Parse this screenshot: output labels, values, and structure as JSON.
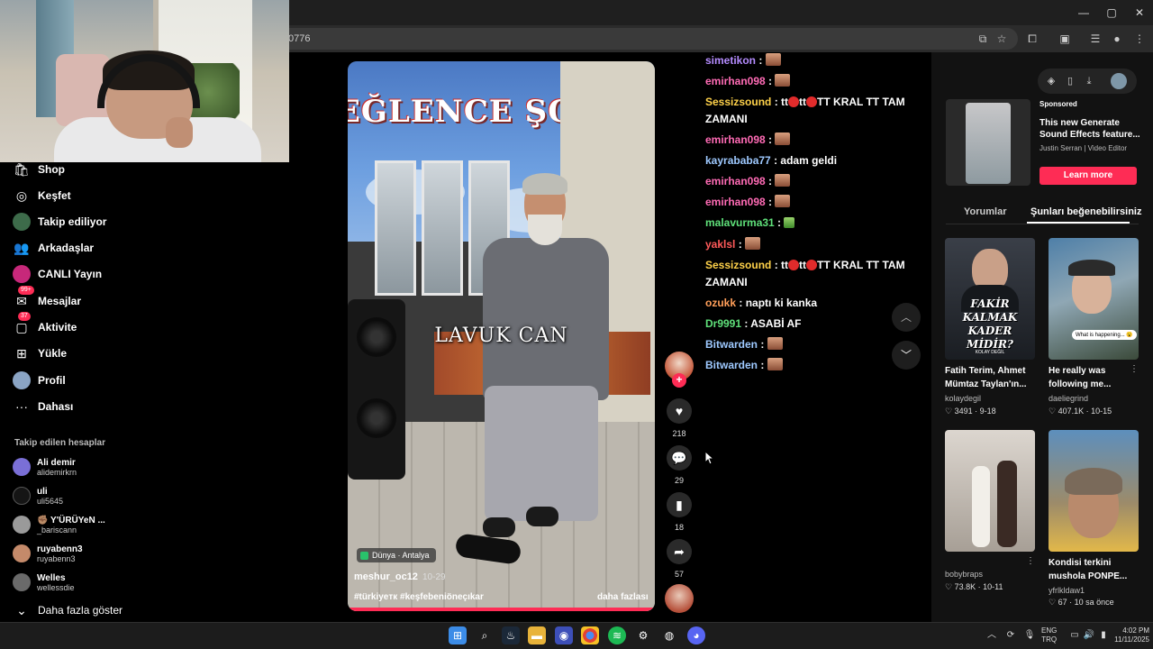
{
  "browser": {
    "url": "0776",
    "window_controls": [
      "—",
      "▢",
      "✕"
    ]
  },
  "sidebar": {
    "nav": [
      {
        "label": "Shop",
        "icon": "shop-icon"
      },
      {
        "label": "Keşfet",
        "icon": "explore-icon"
      },
      {
        "label": "Takip ediliyor",
        "icon": "following-avatar-icon"
      },
      {
        "label": "Arkadaşlar",
        "icon": "friends-icon"
      },
      {
        "label": "CANLI Yayın",
        "icon": "live-avatar-icon"
      },
      {
        "label": "Mesajlar",
        "icon": "messages-icon",
        "badge": "99+"
      },
      {
        "label": "Aktivite",
        "icon": "activity-icon",
        "badge": "37"
      },
      {
        "label": "Yükle",
        "icon": "upload-icon"
      },
      {
        "label": "Profil",
        "icon": "profile-avatar-icon"
      },
      {
        "label": "Dahası",
        "icon": "more-icon"
      }
    ],
    "following_title": "Takip edilen hesaplar",
    "accounts": [
      {
        "name": "Ali demir",
        "handle": "alidemirkrn",
        "color": "#7a6fd6"
      },
      {
        "name": "uli",
        "handle": "uli5645",
        "color": "#111111"
      },
      {
        "name": "✊🏽 Y'ÜRÜYeN ...",
        "handle": "_bariscann",
        "color": "#9a9a9a"
      },
      {
        "name": "ruyabenn3",
        "handle": "ruyabenn3",
        "color": "#c48a6a"
      },
      {
        "name": "Welles",
        "handle": "wellessdie",
        "color": "#6a6a6a"
      }
    ],
    "show_more": "Daha fazla göster"
  },
  "video": {
    "banner_text": "EĞLENCE ŞOV",
    "overlay_text": "LAVUK CAN",
    "location": "Dünya · Antalya",
    "username": "meshur_oc12",
    "date": "10-29",
    "hashtags": "#türkiyeтк #keşfebeniöneçıkar",
    "more_label": "daha fazlası",
    "progress": 1.0
  },
  "actions": {
    "likes": "218",
    "comments": "29",
    "saves": "18",
    "shares": "57"
  },
  "chat": [
    {
      "user": "simetikon",
      "color": "#b58cff",
      "msg": "",
      "emote": "face"
    },
    {
      "user": "emirhan098",
      "color": "#ff6bb5",
      "msg": "",
      "emote": "face"
    },
    {
      "user": "Sessizsound",
      "color": "#ffd24a",
      "msg": "tt",
      "msg2": "tt",
      "msg3": "TT KRAL TT TAM ZAMANI",
      "emote": "reddots"
    },
    {
      "user": "emirhan098",
      "color": "#ff6bb5",
      "msg": "",
      "emote": "face"
    },
    {
      "user": "kayrababa77",
      "color": "#9ec9ff",
      "msg": "adam geldi",
      "emote": ""
    },
    {
      "user": "emirhan098",
      "color": "#ff6bb5",
      "msg": "",
      "emote": "face"
    },
    {
      "user": "emirhan098",
      "color": "#ff6bb5",
      "msg": "",
      "emote": "face"
    },
    {
      "user": "malavurma31",
      "color": "#5fe07a",
      "msg": "",
      "emote": "green"
    },
    {
      "user": "yaklsl",
      "color": "#ff5a5a",
      "msg": "",
      "emote": "face"
    },
    {
      "user": "Sessizsound",
      "color": "#ffd24a",
      "msg": "tt",
      "msg2": "tt",
      "msg3": "TT KRAL TT TAM ZAMANI",
      "emote": "reddots"
    },
    {
      "user": "ozukk",
      "color": "#ff9f5a",
      "msg": "naptı ki kanka",
      "emote": ""
    },
    {
      "user": "Dr9991",
      "color": "#5fe07a",
      "msg": "ASABİ AF",
      "emote": ""
    },
    {
      "user": "Bitwarden",
      "color": "#9ec9ff",
      "msg": "",
      "emote": "face"
    },
    {
      "user": "Bitwarden",
      "color": "#9ec9ff",
      "msg": "",
      "emote": "face"
    }
  ],
  "right": {
    "sponsored_label": "Sponsored",
    "sponsored_title": "This new Generate Sound Effects feature...",
    "sponsored_author": "Justin Serran | Video Editor",
    "learn_more": "Learn more",
    "tabs": [
      "Yorumlar",
      "Şunları beğenebilirsiniz"
    ],
    "cards": [
      {
        "title": "Fatih Terim, Ahmet Mümtaz Taylan'ın...",
        "author": "kolaydegil",
        "likes": "3491",
        "date": "9-18",
        "thumb_text": "FAKİR KALMAK KADER MİDİR?",
        "thumb_small": "KOLAY DEĞİL"
      },
      {
        "title": "He really was following me...",
        "author": "daeliegrind",
        "likes": "407.1K",
        "date": "10-15",
        "thumb_bubble": "What is happening... 😮"
      },
      {
        "title": "",
        "author": "bobybraps",
        "likes": "73.8K",
        "date": "10-11"
      },
      {
        "title": "Kondisi terkini mushola PONPE...",
        "author": "yfrlkldaw1",
        "likes": "67",
        "date": "10 sa önce"
      }
    ]
  },
  "taskbar": {
    "lang_top": "ENG",
    "lang_bottom": "TRQ",
    "time": "4:02 PM",
    "date": "11/11/2025"
  }
}
